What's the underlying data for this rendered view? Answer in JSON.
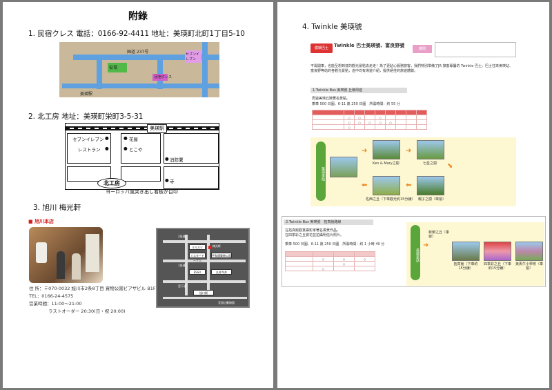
{
  "left_page": {
    "title": "附錄",
    "s1": "1. 民宿クレス 電話：0166-92-4411 地址：美瑛町北町1丁目5-10",
    "s2": "2. 北工房 地址：美瑛町栄町3-5-31",
    "s3": "3. 旭川 梅光軒",
    "map1_labels": [
      "国道 237号",
      "役場",
      "セブンイレブン",
      "民宿クレス",
      "美瑛駅"
    ],
    "map2": {
      "station": "美瑛駅",
      "shops": [
        "セブンイレブン",
        "レストラン",
        "花屋",
        "とこや",
        "消防署",
        "寺"
      ],
      "sign": "北工房",
      "note": "ヨーロッパ風突き出し看板が目印"
    },
    "shop_name": "旭川本店",
    "info": [
      "住 所：〒070-0032 旭川市2条8丁目 買物公園ビアザビル B1F",
      "TEL：0166-24-4575",
      "営業時間：11:00～21:00",
      "ラストオーダー 20:30(日・祝 20:00)"
    ],
    "map3_labels": [
      "2条通",
      "マルカツ",
      "梅光軒",
      "1条通",
      "ミスタードーナツ",
      "平和通買物公園",
      "ESSO",
      "丸井今井",
      "宮下通",
      "旭川駅",
      "至旭山動物園"
    ]
  },
  "right_page": {
    "s4": "4. Twinkle 美瑛號",
    "flyer1": {
      "badge": "循環巴士",
      "title": "Twinkle 巴士美瑛號、富良野號",
      "dates": "期間",
      "intro": "不需開車，也能至想到達的觀光景點去走走！為了更貼心服務旅客，我們特別準備了JR 旅客專屬的 Twinkle 巴士。巴士往來美瑛站、富良野等站的各觀光景點，途中均有導遊介紹，提供絕佳的旅遊體驗。",
      "route": "1.Twinkle Bus 美瑛號 丘陵周遊",
      "sub1": "周遊美瑛丘陵著名景點。",
      "fare": "乘車 500 日圓、6-11 歲 250 日圓　所需時間：約 55 分",
      "stops": [
        "美瑛車站",
        "Ken & Mary之樹",
        "七星之樹",
        "佐西之丘（下車觀光約15分鐘）",
        "親子之樹（車窗）"
      ]
    },
    "flyer2": {
      "route": "2.Twinkle Bus 美瑛號　拓真館路線",
      "desc1": "在拓真館觀賞攝影家著名風景作品。",
      "desc2": "在四季彩之丘賞花並拍攝明信片照片。",
      "fare": "乘車 500 日圓、6-11 歲 250 日圓　所需時間：約 1 小時 40 分",
      "stops": [
        "美瑛車站",
        "新榮之丘（車窗）",
        "拓真館（下車約15分鐘）",
        "四季彩之丘（下車約15分鐘）",
        "美馬牛小學校（車窗）"
      ]
    }
  }
}
